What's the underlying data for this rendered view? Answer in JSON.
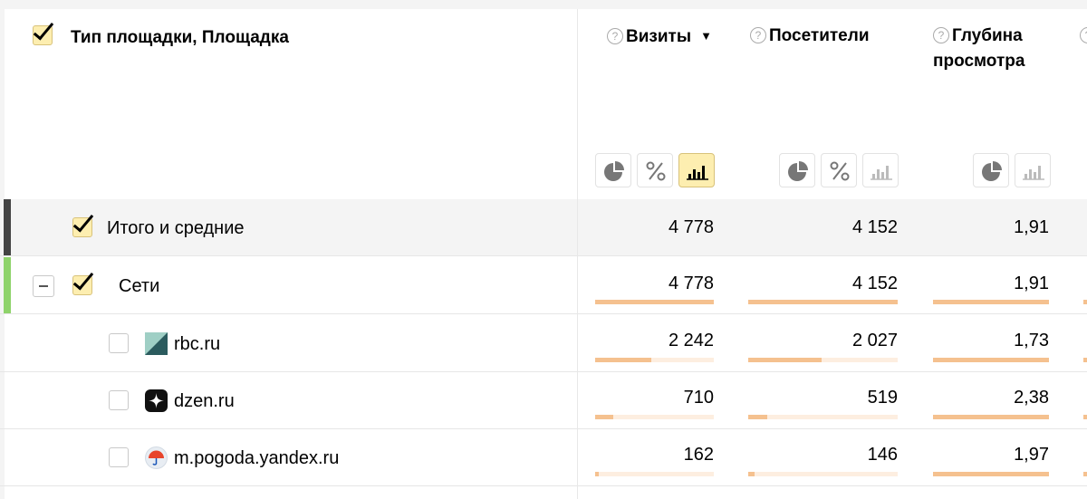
{
  "header": {
    "dimension_title": "Тип площадки, Площадка",
    "metrics": [
      {
        "title": "Визиты",
        "help": "?",
        "sort": "▼"
      },
      {
        "title": "Посетители",
        "help": "?"
      },
      {
        "title_line1": "Глубина",
        "title_line2": "просмотра",
        "help": "?"
      }
    ],
    "next_help": "?"
  },
  "rows": [
    {
      "label": "Итого и средние",
      "visits": "4 778",
      "visitors": "4 152",
      "depth": "1,91",
      "checked": true
    },
    {
      "label": "Сети",
      "visits": "4 778",
      "visitors": "4 152",
      "depth": "1,91",
      "checked": true,
      "expanded": true,
      "visits_share": 1.0,
      "visitors_share": 1.0,
      "depth_share": 1.0
    },
    {
      "label": "rbc.ru",
      "visits": "2 242",
      "visitors": "2 027",
      "depth": "1,73",
      "checked": false,
      "visits_share": 0.47,
      "visitors_share": 0.49,
      "depth_share": 1.0,
      "icon": "rbc-favicon-icon"
    },
    {
      "label": "dzen.ru",
      "visits": "710",
      "visitors": "519",
      "depth": "2,38",
      "checked": false,
      "visits_share": 0.15,
      "visitors_share": 0.13,
      "depth_share": 1.0,
      "icon": "dzen-favicon-icon"
    },
    {
      "label": "m.pogoda.yandex.ru",
      "visits": "162",
      "visitors": "146",
      "depth": "1,97",
      "checked": false,
      "visits_share": 0.03,
      "visitors_share": 0.04,
      "depth_share": 1.0,
      "icon": "pogoda-favicon-icon"
    }
  ],
  "colors": {
    "accent": "#fdeeb0",
    "bar": "#f5c18f",
    "bar_bg": "#fdeee0",
    "total_marker": "#444444",
    "group_marker": "#8fd36b"
  }
}
